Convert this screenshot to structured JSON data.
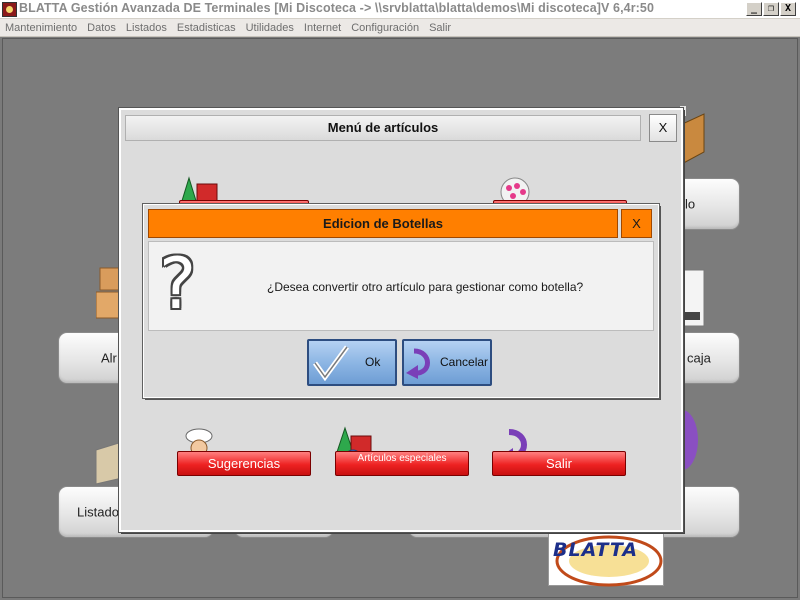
{
  "window": {
    "title": "BLATTA Gestión Avanzada DE Terminales [Mi Discoteca -> \\\\srvblatta\\blatta\\demos\\Mi discoteca]V 6,4r:50",
    "min_label": "_",
    "restore_label": "❐",
    "close_label": "X"
  },
  "menu": {
    "items": [
      "Mantenimiento",
      "Datos",
      "Listados",
      "Estadisticas",
      "Utilidades",
      "Internet",
      "Configuración",
      "Salir"
    ]
  },
  "background": {
    "btn_right1": "lo",
    "btn_left2": "Alr",
    "btn_right2": "caja",
    "btn_left3": "Listado",
    "logo_text": "BLATTA"
  },
  "articulos_dialog": {
    "title": "Menú de artículos",
    "close_label": "X",
    "buttons": {
      "sugerencias": "Sugerencias",
      "especiales": "Artículos especiales",
      "salir": "Salir"
    }
  },
  "botellas_dialog": {
    "title": "Edicion de Botellas",
    "close_label": "X",
    "question_glyph": "?",
    "message": "¿Desea convertir otro artículo para gestionar como botella?",
    "ok_label": "Ok",
    "cancel_label": "Cancelar"
  },
  "colors": {
    "orange_title": "#ff7f00",
    "red_button": "#ee2222",
    "blue_button": "#8db6e4",
    "desktop": "#7c7c7c"
  },
  "icons": [
    "app-icon",
    "question-icon",
    "check-icon",
    "undo-arrow-icon",
    "chef-icon",
    "shapes-icon",
    "boxes-icon",
    "printer-icon"
  ]
}
